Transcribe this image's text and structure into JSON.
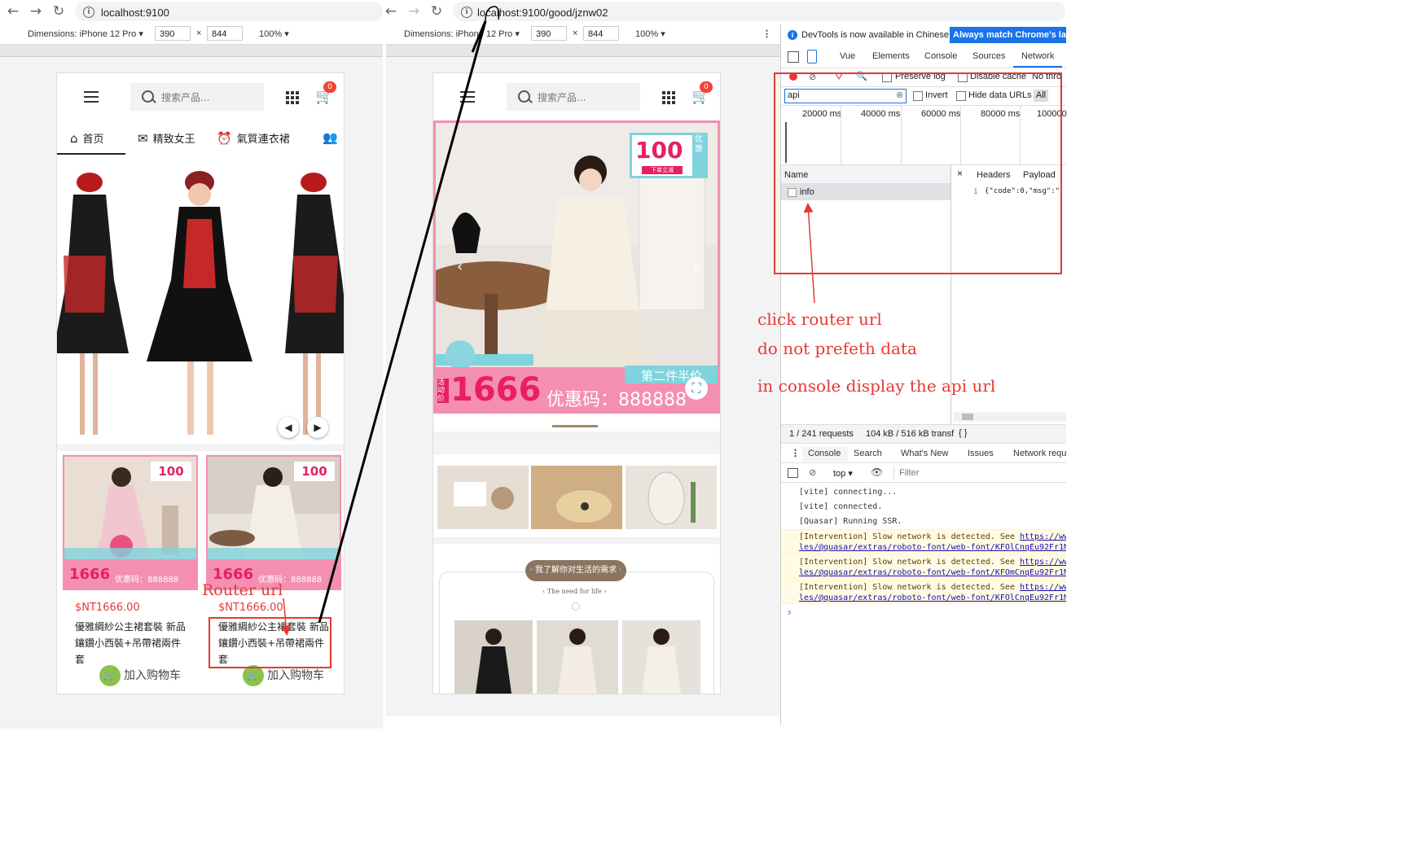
{
  "left_browser": {
    "url": "localhost:9100",
    "device_label": "Dimensions: iPhone 12 Pro",
    "width_value": "390",
    "height_value": "844",
    "zoom": "100%",
    "header": {
      "search_placeholder": "搜索产品...",
      "cart_count": "0"
    },
    "tabs": [
      {
        "label": "首页",
        "icon": "home-icon"
      },
      {
        "label": "精致女王",
        "icon": "mail-icon"
      },
      {
        "label": "氣質連衣裙",
        "icon": "alarm-icon"
      },
      {
        "label": "",
        "icon": "people-icon"
      }
    ],
    "products": [
      {
        "image_text": "100",
        "promo_price": "1666",
        "promo_code": "优惠码：888888",
        "price": "$NT1666.00",
        "title": "優雅綢紗公主裙套裝 新品鑲鑽小西裝+吊帶裙兩件套",
        "add_label": "加入购物车"
      },
      {
        "image_text": "100",
        "promo_price": "1666",
        "promo_code": "优惠码：888888",
        "price": "$NT1666.00",
        "title": "優雅綢紗公主裙套裝 新品鑲鑽小西裝+吊帶裙兩件套",
        "add_label": "加入购物车"
      }
    ]
  },
  "right_browser": {
    "url": "localhost:9100/good/jznw02",
    "device_label": "Dimensions: iPhone 12 Pro",
    "width_value": "390",
    "height_value": "844",
    "zoom": "100%",
    "header": {
      "search_placeholder": "搜索产品...",
      "cart_count": "0"
    },
    "banner": {
      "badge": "100",
      "badge_side": "优惠",
      "badge_sub": "下单立减",
      "second_half": "第二件半价",
      "promo_tag": "活动价",
      "price": "1666",
      "code": "优惠码：888888"
    },
    "section_title": "· 我了解你对生活的需求 ·",
    "section_sub": "The need for life"
  },
  "devtools": {
    "notice": "DevTools is now available in Chinese!",
    "notice_button": "Always match Chrome's lang",
    "tabs": [
      "Vue",
      "Elements",
      "Console",
      "Sources",
      "Network"
    ],
    "active_tab": "Network",
    "preserve_log": "Preserve log",
    "disable_cache": "Disable cache",
    "throttle": "No thro",
    "filter_value": "api",
    "invert": "Invert",
    "hide_data_urls": "Hide data URLs",
    "all_label": "All",
    "timeline": [
      "20000 ms",
      "40000 ms",
      "60000 ms",
      "80000 ms",
      "100000"
    ],
    "name_header": "Name",
    "request_name": "info",
    "detail_tabs": [
      "Headers",
      "Payload"
    ],
    "response_line_no": "1",
    "response_preview": "{\"code\":0,\"msg\":\"",
    "status_requests": "1 / 241 requests",
    "status_transferred": "104 kB / 516 kB transf",
    "drawer_tabs": [
      "Console",
      "Search",
      "What's New",
      "Issues",
      "Network requ"
    ],
    "context": "top",
    "filter_placeholder": "Filter",
    "console_lines": [
      {
        "text": "[vite] connecting...",
        "type": "log"
      },
      {
        "text": "[vite] connected.",
        "type": "log"
      },
      {
        "text": "[Quasar] Running SSR.",
        "type": "log"
      },
      {
        "text": "[Intervention] Slow network is detected. See ",
        "link": "https://ww",
        "link2": "les/@quasar/extras/roboto-font/web-font/KFOlCnqEu92Fr1M",
        "type": "warn"
      },
      {
        "text": "[Intervention] Slow network is detected. See ",
        "link": "https://ww",
        "link2": "les/@quasar/extras/roboto-font/web-font/KFOmCnqEu92Fr1M",
        "type": "warn"
      },
      {
        "text": "[Intervention] Slow network is detected. See ",
        "link": "https://ww",
        "link2": "les/@quasar/extras/roboto-font/web-font/KFOlCnqEu92Fr1M",
        "type": "warn"
      }
    ],
    "prompt": "›"
  },
  "annotations": {
    "router_url": "Router url",
    "line1": "click router url",
    "line2": "do not prefeth data",
    "line3": "in console display the api url"
  },
  "colors": {
    "annotation_red": "#e53935",
    "chrome_blue": "#1a73e8",
    "pink": "#f48fb1"
  }
}
